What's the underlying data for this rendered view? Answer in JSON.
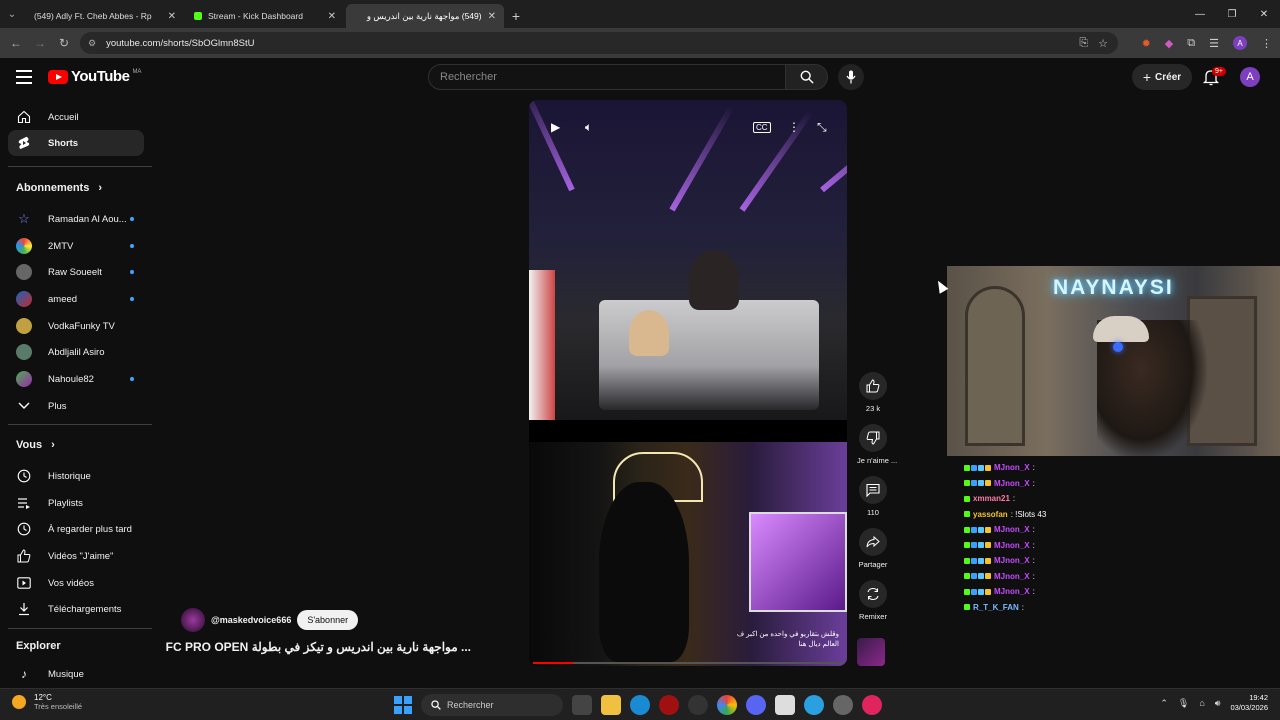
{
  "browser": {
    "tabs": [
      {
        "label": "(549) Adly Ft. Cheb Abbes - Rp",
        "favicon": "youtube",
        "active": false
      },
      {
        "label": "Stream - Kick Dashboard",
        "favicon": "kick",
        "active": false
      },
      {
        "label": "(549) مواجهة نارية بين اندريس و",
        "favicon": "youtube",
        "active": true
      }
    ],
    "url": "youtube.com/shorts/SbOGlmn8StU"
  },
  "youtube": {
    "logo_text": "YouTube",
    "logo_country": "MA",
    "search_placeholder": "Rechercher",
    "create_label": "Créer",
    "notifications_badge": "9+",
    "account_initial": "A",
    "sidebar": {
      "main": [
        {
          "label": "Accueil",
          "icon": "home-icon"
        },
        {
          "label": "Shorts",
          "icon": "shorts-icon",
          "active": true
        }
      ],
      "subscriptions_title": "Abonnements",
      "subscriptions": [
        {
          "label": "Ramadan Al Aou...",
          "color": "#1a237e",
          "new": true
        },
        {
          "label": "2MTV",
          "color": "#8bc34a",
          "new": true
        },
        {
          "label": "Raw Soueelt",
          "color": "#555555",
          "new": true
        },
        {
          "label": "ameed",
          "color": "#1565c0",
          "new": true
        },
        {
          "label": "VodkaFunky TV",
          "color": "#c0a040",
          "new": false
        },
        {
          "label": "Abdljalil Asiro",
          "color": "#4a6a4a",
          "new": false
        },
        {
          "label": "Nahoule82",
          "color": "#6a3aa0",
          "new": true
        }
      ],
      "more_label": "Plus",
      "you_title": "Vous",
      "you_items": [
        {
          "label": "Historique",
          "icon": "history-icon"
        },
        {
          "label": "Playlists",
          "icon": "playlist-icon"
        },
        {
          "label": "À regarder plus tard",
          "icon": "watch-later-icon"
        },
        {
          "label": "Vidéos \"J'aime\"",
          "icon": "like-icon"
        },
        {
          "label": "Vos vidéos",
          "icon": "video-icon"
        },
        {
          "label": "Téléchargements",
          "icon": "download-icon"
        }
      ],
      "explore_title": "Explorer",
      "explore_items": [
        {
          "label": "Musique",
          "icon": "music-icon"
        }
      ]
    },
    "short": {
      "caption_text": "وقلش بتقاريو في واحده من اكبر ف العالم ديال هنا",
      "channel": "@maskedvoice666",
      "subscribe_label": "S'abonner",
      "title": "... مواجهة نارية بين اندريس و تيكز في بطولة FC PRO OPEN",
      "progress_fraction": 0.13,
      "actions": {
        "likes": "23 k",
        "dislike_label": "Je n'aime ...",
        "comments": "110",
        "share_label": "Partager",
        "remix_label": "Remixer"
      }
    }
  },
  "stream_overlay": {
    "neon_text": "NAYNAYSI",
    "chat": [
      {
        "user": "MJnon_X",
        "msg": ":",
        "color": "#c64bff",
        "badges": 4
      },
      {
        "user": "MJnon_X",
        "msg": ":",
        "color": "#c64bff",
        "badges": 4
      },
      {
        "user": "xmman21",
        "msg": ":",
        "color": "#ff7aa8",
        "badges": 1
      },
      {
        "user": "yassofan",
        "msg": ": !Slots 43",
        "color": "#f4c430",
        "badges": 1
      },
      {
        "user": "MJnon_X",
        "msg": ":",
        "color": "#c64bff",
        "badges": 4
      },
      {
        "user": "MJnon_X",
        "msg": ":",
        "color": "#c64bff",
        "badges": 4
      },
      {
        "user": "MJnon_X",
        "msg": ":",
        "color": "#c64bff",
        "badges": 4
      },
      {
        "user": "MJnon_X",
        "msg": ":",
        "color": "#c64bff",
        "badges": 4
      },
      {
        "user": "MJnon_X",
        "msg": ":",
        "color": "#c64bff",
        "badges": 4
      },
      {
        "user": "R_T_K_FAN",
        "msg": ":",
        "color": "#7ab8ff",
        "badges": 1
      }
    ]
  },
  "taskbar": {
    "weather_temp": "12°C",
    "weather_desc": "Très ensoleillé",
    "search_placeholder": "Rechercher",
    "time": "19:42",
    "date": "03/03/2026"
  },
  "colors": {
    "youtube_red": "#ff0000",
    "kick_green": "#53fc18",
    "accent_blue": "#3ea6ff"
  }
}
